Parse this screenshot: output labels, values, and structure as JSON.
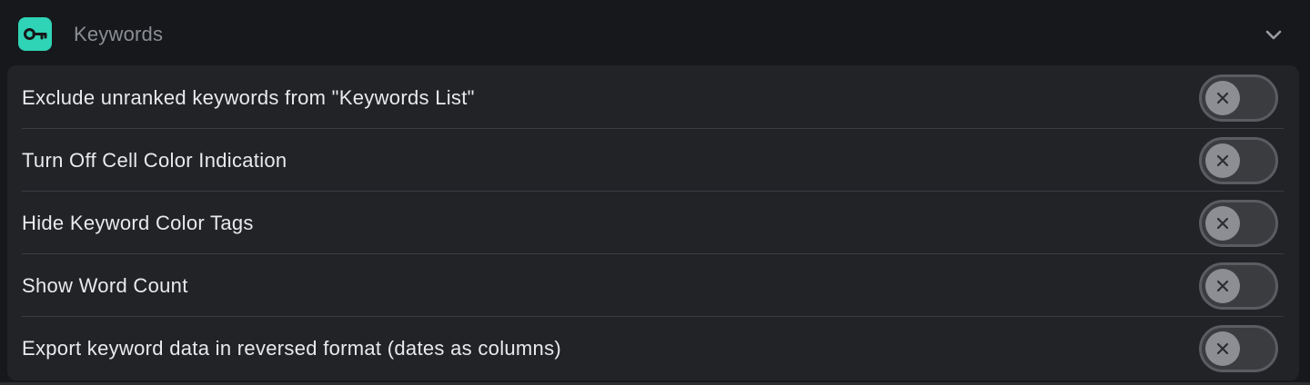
{
  "section": {
    "title": "Keywords",
    "icon": "key-icon",
    "accent_color": "#2fd3b5",
    "collapse_icon": "chevron-down-icon",
    "expanded": true
  },
  "settings": [
    {
      "label": "Exclude unranked keywords from \"Keywords List\"",
      "enabled": false
    },
    {
      "label": "Turn Off Cell Color Indication",
      "enabled": false
    },
    {
      "label": "Hide Keyword Color Tags",
      "enabled": false
    },
    {
      "label": "Show Word Count",
      "enabled": false
    },
    {
      "label": "Export keyword data in reversed format (dates as columns)",
      "enabled": false
    }
  ]
}
